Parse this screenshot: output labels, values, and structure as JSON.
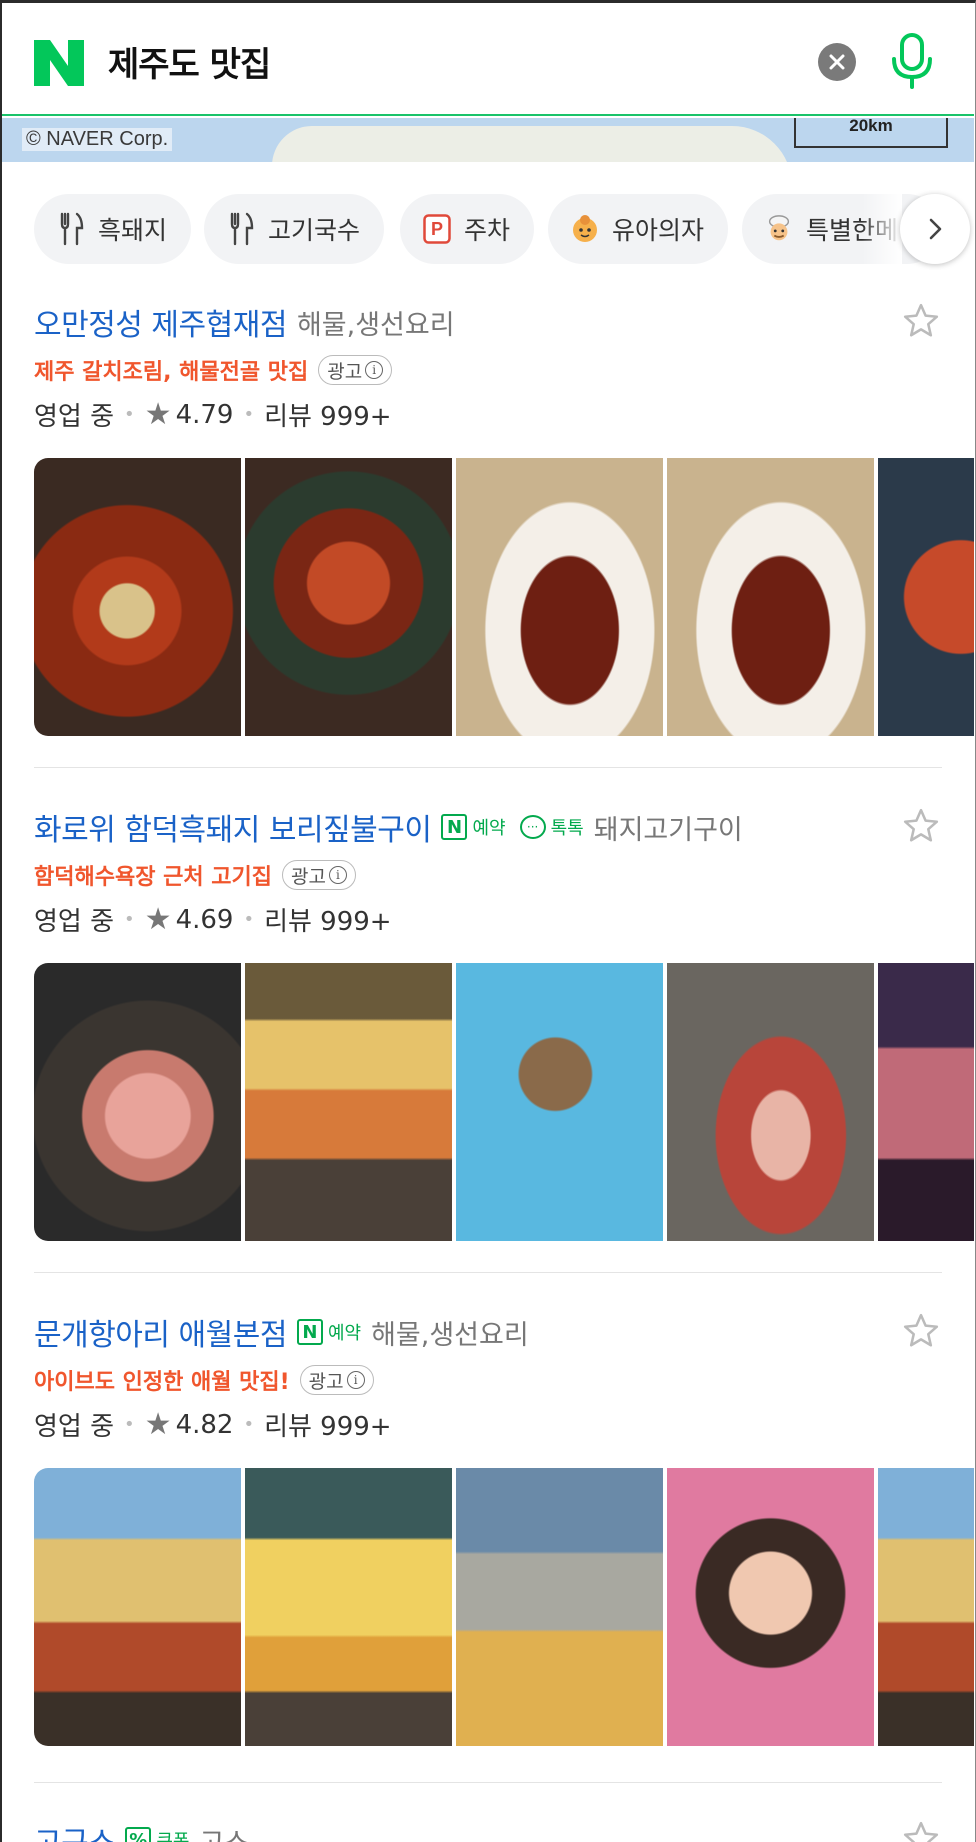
{
  "search": {
    "query": "제주도 맛집",
    "logo_letter": "N"
  },
  "map": {
    "credit": "© NAVER Corp.",
    "scale": "20km"
  },
  "chips": [
    {
      "label": "흑돼지",
      "icon": "fork-knife-icon"
    },
    {
      "label": "고기국수",
      "icon": "fork-knife-icon"
    },
    {
      "label": "주차",
      "icon": "parking-icon"
    },
    {
      "label": "유아의자",
      "icon": "baby-icon"
    },
    {
      "label": "특별한메",
      "icon": "chef-icon"
    }
  ],
  "results": [
    {
      "name": "오만정성 제주협재점",
      "category": "해물,생선요리",
      "ad_text": "제주 갈치조림, 해물전골 맛집",
      "ad_label": "광고",
      "status": "영업 중",
      "rating": "4.79",
      "reviews": "리뷰 999+",
      "badges": []
    },
    {
      "name": "화로위 함덕흑돼지 보리짚불구이",
      "category": "돼지고기구이",
      "ad_text": "함덕해수욕장 근처 고기집",
      "ad_label": "광고",
      "status": "영업 중",
      "rating": "4.69",
      "reviews": "리뷰 999+",
      "badges": [
        "예약",
        "톡톡"
      ]
    },
    {
      "name": "문개항아리 애월본점",
      "category": "해물,생선요리",
      "ad_text": "아이브도 인정한 애월 맛집!",
      "ad_label": "광고",
      "status": "영업 중",
      "rating": "4.82",
      "reviews": "리뷰 999+",
      "badges": [
        "예약"
      ]
    }
  ],
  "peek": {
    "name": "고구스",
    "badge": "쿠폰",
    "category": "고스"
  },
  "colors": {
    "brand_green": "#03c75a",
    "link_blue": "#1a62c7",
    "ad_orange": "#f0562d"
  }
}
